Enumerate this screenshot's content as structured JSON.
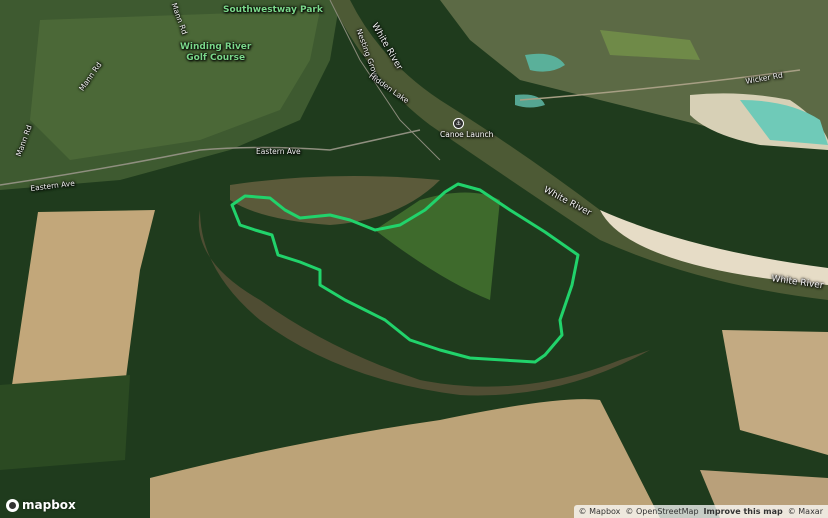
{
  "map": {
    "labels": {
      "park": "Southwestway Park",
      "golf": "Winding River\nGolf Course",
      "canoe": "Canoe Launch",
      "eastern_ave_1": "Eastern Ave",
      "eastern_ave_2": "Eastern Ave",
      "mann_rd_1": "Mann Rd",
      "mann_rd_2": "Mann Rd",
      "mann_rd_3": "Mann Rd",
      "wicker_rd": "Wicker Rd",
      "white_river_1": "White River",
      "white_river_2": "White River",
      "white_river_3": "White River",
      "nesting_grove": "Nesting Grove",
      "hidden_lake": "Hidden Lake"
    },
    "colors": {
      "boundary": "#21d36b",
      "river": "#4e5a36",
      "forest": "#1c3a1a",
      "field": "#c2a77a"
    }
  },
  "branding": {
    "logo_text": "mapbox",
    "attribution": {
      "mapbox": "© Mapbox",
      "osm": "© OpenStreetMap",
      "improve": "Improve this map",
      "maxar": "© Maxar"
    }
  }
}
